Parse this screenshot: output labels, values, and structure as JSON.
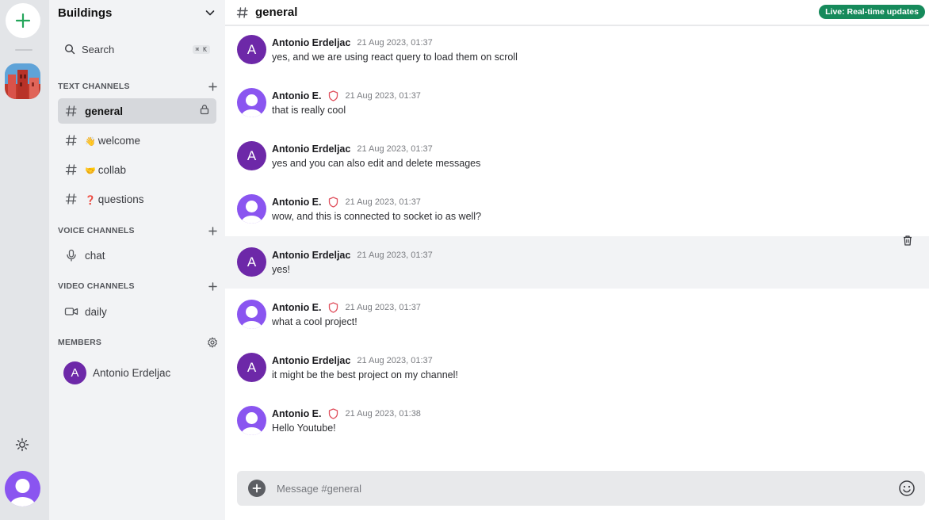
{
  "server": {
    "name": "Buildings"
  },
  "search": {
    "label": "Search",
    "shortcut": "⌘ K"
  },
  "sections": {
    "text": {
      "title": "TEXT CHANNELS"
    },
    "voice": {
      "title": "VOICE CHANNELS"
    },
    "video": {
      "title": "VIDEO CHANNELS"
    },
    "members": {
      "title": "MEMBERS"
    }
  },
  "text_channels": [
    {
      "label": "general",
      "emoji": "",
      "active": true
    },
    {
      "label": "welcome",
      "emoji": "👋"
    },
    {
      "label": "collab",
      "emoji": "🤝"
    },
    {
      "label": "questions",
      "emoji": "❓"
    }
  ],
  "voice_channels": [
    {
      "label": "chat"
    }
  ],
  "video_channels": [
    {
      "label": "daily"
    }
  ],
  "members": [
    {
      "initial": "A",
      "name": "Antonio Erdeljac"
    }
  ],
  "header": {
    "title": "general",
    "badge": "Live: Real-time updates"
  },
  "messages": [
    {
      "author": "Antonio Erdeljac",
      "avatar": "A",
      "time": "21 Aug 2023, 01:37",
      "text": "yes, and we are using react query to load them on scroll"
    },
    {
      "author": "Antonio E.",
      "avatar": "user",
      "moderator": true,
      "time": "21 Aug 2023, 01:37",
      "text": "that is really cool"
    },
    {
      "author": "Antonio Erdeljac",
      "avatar": "A",
      "time": "21 Aug 2023, 01:37",
      "text": "yes and you can also edit and delete messages"
    },
    {
      "author": "Antonio E.",
      "avatar": "user",
      "moderator": true,
      "time": "21 Aug 2023, 01:37",
      "text": "wow, and this is connected to socket io as well?"
    },
    {
      "author": "Antonio Erdeljac",
      "avatar": "A",
      "time": "21 Aug 2023, 01:37",
      "text": "yes!",
      "hovered": true
    },
    {
      "author": "Antonio E.",
      "avatar": "user",
      "moderator": true,
      "time": "21 Aug 2023, 01:37",
      "text": "what a cool project!"
    },
    {
      "author": "Antonio Erdeljac",
      "avatar": "A",
      "time": "21 Aug 2023, 01:37",
      "text": "it might be the best project on my channel!"
    },
    {
      "author": "Antonio E.",
      "avatar": "user",
      "moderator": true,
      "time": "21 Aug 2023, 01:38",
      "text": "Hello Youtube!"
    }
  ],
  "composer": {
    "placeholder": "Message #general"
  },
  "colors": {
    "accent_purple": "#6d28a8",
    "user_avatar": "#8a55f0",
    "live_badge": "#168a5b",
    "mod_shield": "#e0525f",
    "add_green": "#23a55a"
  }
}
